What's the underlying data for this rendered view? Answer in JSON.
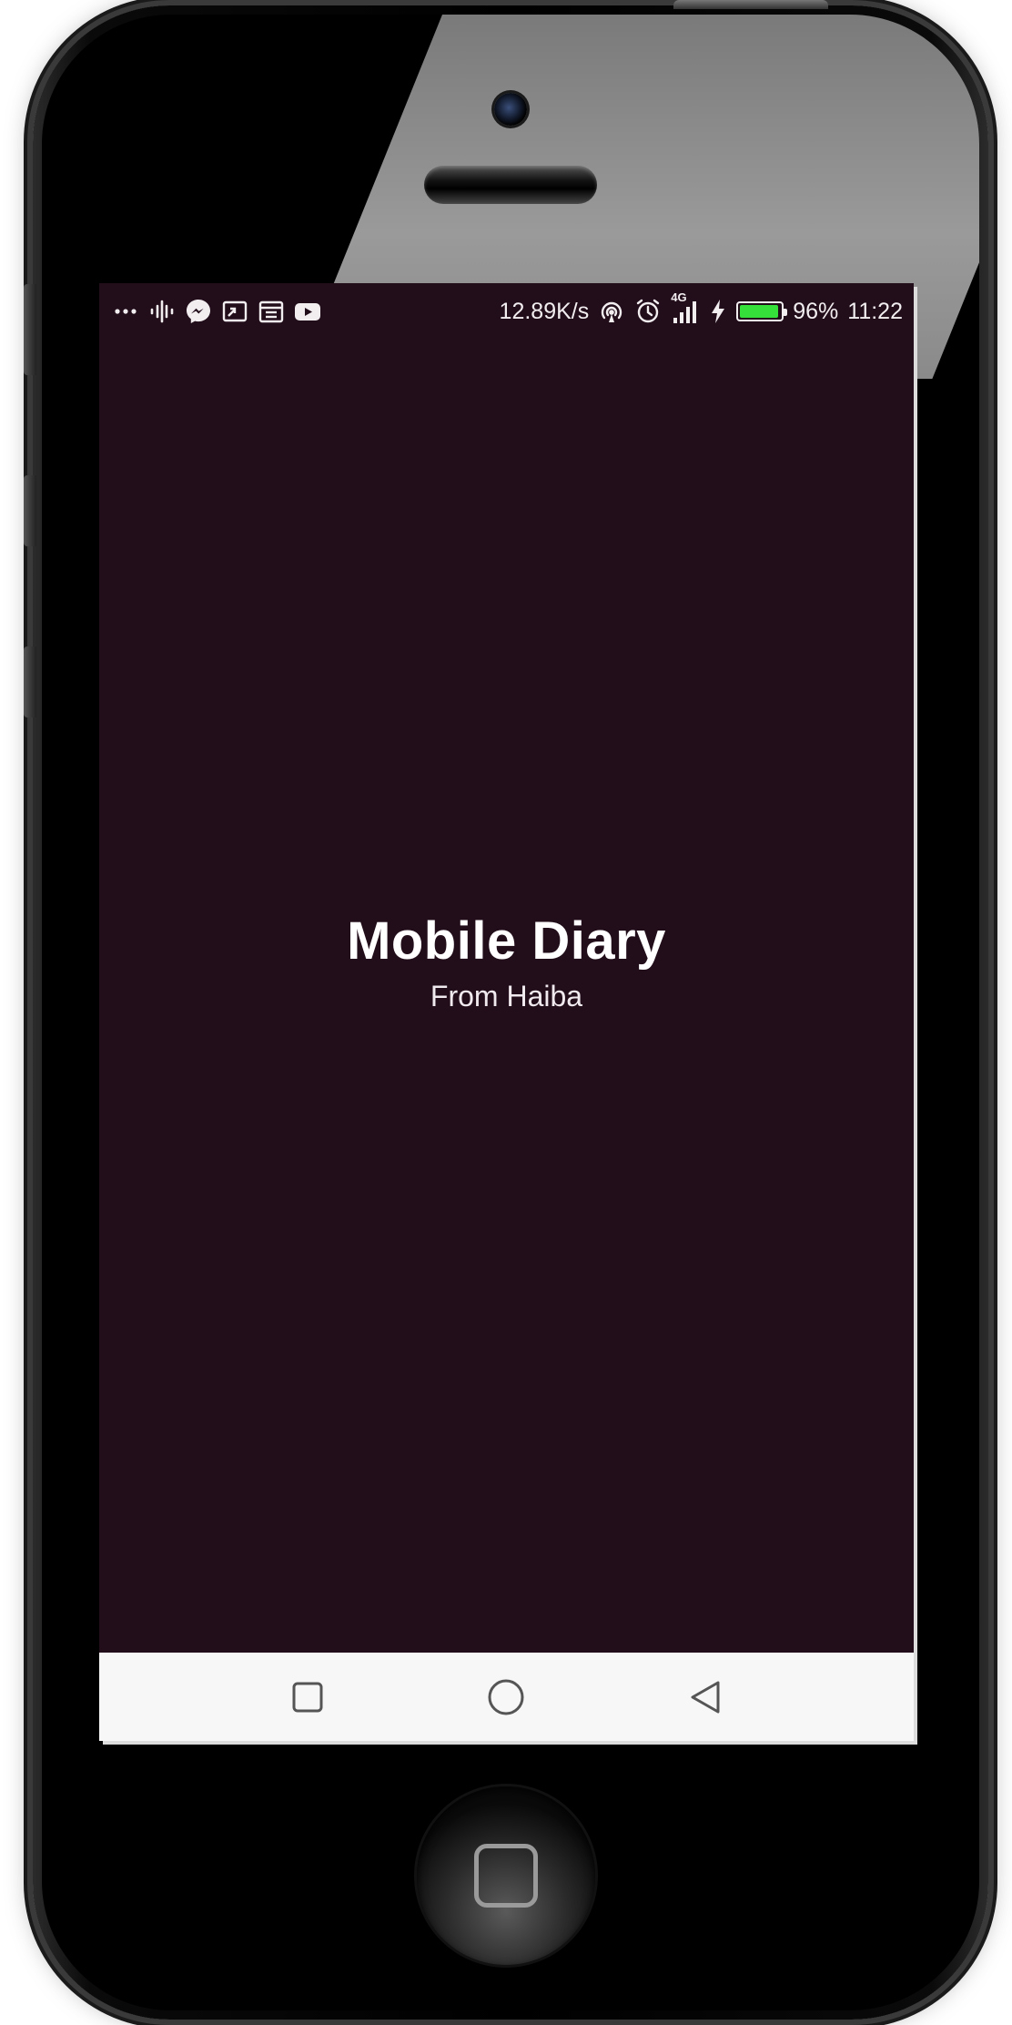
{
  "app": {
    "title": "Mobile Diary",
    "subtitle": "From Haiba",
    "background_color": "#220d1a"
  },
  "status_bar": {
    "left_icons": [
      "more-dots-icon",
      "audio-wave-icon",
      "messenger-icon",
      "cast-icon",
      "calendar-icon",
      "youtube-icon"
    ],
    "network_speed": "12.89K/s",
    "right_icons": [
      "hotspot-icon",
      "alarm-icon",
      "signal-4g-icon",
      "charging-icon"
    ],
    "network_type": "4G",
    "battery_level": 0.96,
    "battery_text": "96%",
    "battery_color": "#35e03a",
    "time": "11:22"
  },
  "nav_bar": {
    "buttons": [
      "recent-apps-button",
      "home-nav-button",
      "back-button"
    ]
  }
}
